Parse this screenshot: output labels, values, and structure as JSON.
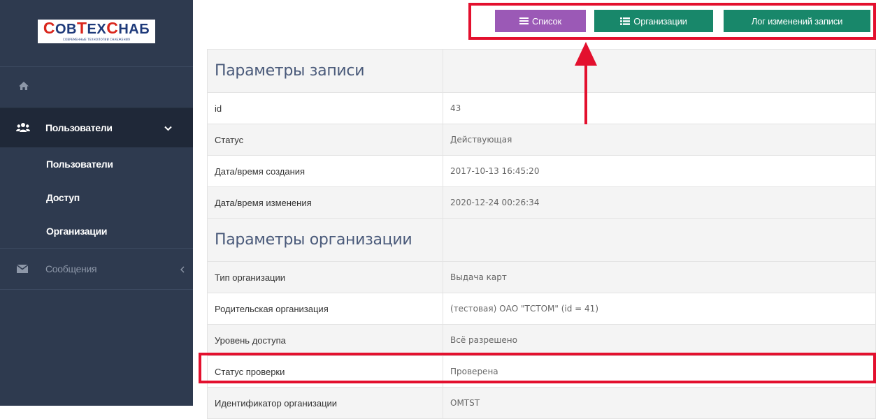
{
  "logo": {
    "word_parts": [
      "С",
      "ОВ",
      "Т",
      "ЕХ",
      "С",
      "НАБ"
    ],
    "tagline": "СОВРЕМЕННЫЕ ТЕХНОЛОГИИ СНАБЖЕНИЯ"
  },
  "sidebar": {
    "home_icon": "home-icon",
    "group_label": "Пользователи",
    "sub_items": [
      {
        "label": "Пользователи"
      },
      {
        "label": "Доступ"
      },
      {
        "label": "Организации"
      }
    ],
    "messages_label": "Сообщения"
  },
  "toolbar": {
    "list_label": "Список",
    "orgs_label": "Организации",
    "log_label": "Лог изменений записи"
  },
  "record": {
    "section1_title": "Параметры записи",
    "id_label": "id",
    "id_value": "43",
    "status_label": "Статус",
    "status_value": "Действующая",
    "created_label": "Дата/время создания",
    "created_value": "2017-10-13 16:45:20",
    "modified_label": "Дата/время изменения",
    "modified_value": "2020-12-24 00:26:34"
  },
  "organization": {
    "section2_title": "Параметры организации",
    "type_label": "Тип организации",
    "type_value": "Выдача карт",
    "parent_label": "Родительская организация",
    "parent_value": "(тестовая) ОАО \"ТСТОМ\" (id = 41)",
    "access_label": "Уровень доступа",
    "access_value": "Всё разрешено",
    "check_label": "Статус проверки",
    "check_value": "Проверена",
    "ident_label": "Идентификатор организации",
    "ident_value": "OMTST"
  },
  "colors": {
    "sidebar_bg": "#2e3a4f",
    "sidebar_active_bg": "#1f2838",
    "list_button": "#9b59b6",
    "green_button": "#18876a",
    "highlight": "#e3102e"
  }
}
